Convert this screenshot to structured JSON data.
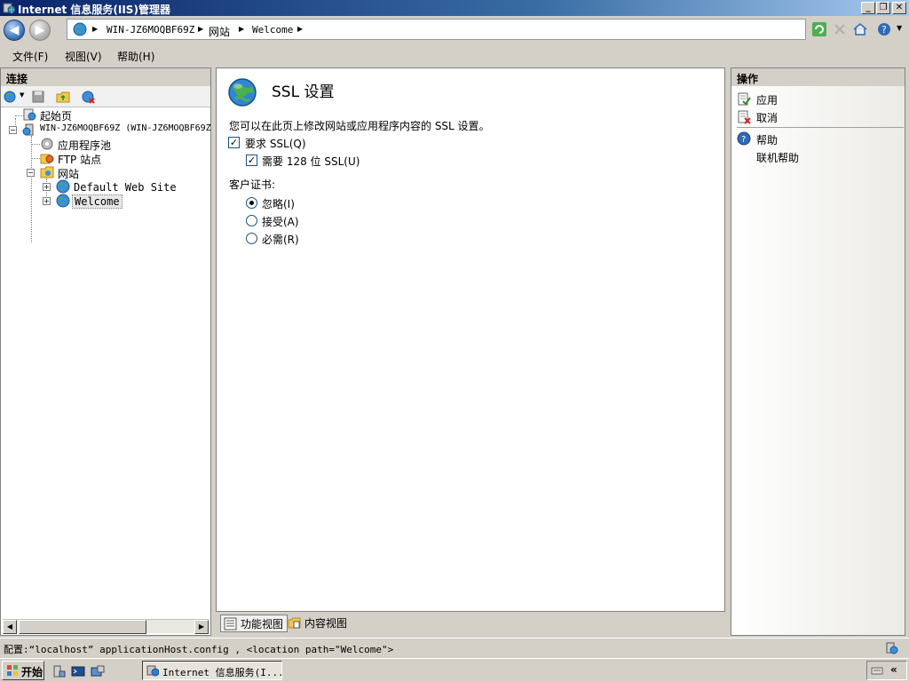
{
  "window": {
    "title": "Internet 信息服务(IIS)管理器",
    "minimize_label": "_",
    "restore_label": "❐",
    "close_label": "✕"
  },
  "address": {
    "back_glyph": "◀",
    "forward_glyph": "▶",
    "crumbs": [
      "WIN-JZ6MOQBF69Z",
      "网站",
      "Welcome"
    ]
  },
  "menu": {
    "items": [
      "文件(F)",
      "视图(V)",
      "帮助(H)"
    ]
  },
  "connections": {
    "title": "连接",
    "tree": [
      {
        "label": "起始页"
      },
      {
        "label": "WIN-JZ6MOQBF69Z (WIN-JZ6MOQBF69Z"
      },
      {
        "label": "应用程序池"
      },
      {
        "label": "FTP 站点"
      },
      {
        "label": "网站"
      },
      {
        "label": "Default Web Site"
      },
      {
        "label": "Welcome"
      }
    ]
  },
  "content": {
    "title": "SSL 设置",
    "description": "您可以在此页上修改网站或应用程序内容的 SSL 设置。",
    "require_ssl": {
      "label": "要求 SSL(Q)",
      "checked": true
    },
    "require_128": {
      "label": "需要 128 位 SSL(U)",
      "checked": true
    },
    "client_cert_label": "客户证书:",
    "client_cert_options": [
      {
        "label": "忽略(I)",
        "selected": true
      },
      {
        "label": "接受(A)",
        "selected": false
      },
      {
        "label": "必需(R)",
        "selected": false
      }
    ],
    "check_glyph": "✓"
  },
  "view_tabs": {
    "features": "功能视图",
    "content": "内容视图"
  },
  "actions": {
    "title": "操作",
    "apply": "应用",
    "cancel": "取消",
    "help": "帮助",
    "online_help": "联机帮助"
  },
  "status": {
    "text": "配置:“localhost” applicationHost.config , <location path=\"Welcome\">"
  },
  "taskbar": {
    "start": "开始",
    "task_button": "Internet 信息服务(I...",
    "tray_glyph": "«"
  },
  "colors": {
    "titlebar_start": "#0a246a",
    "titlebar_end": "#a6caf0",
    "chrome": "#d4d0c8",
    "panel_border": "#808080"
  }
}
